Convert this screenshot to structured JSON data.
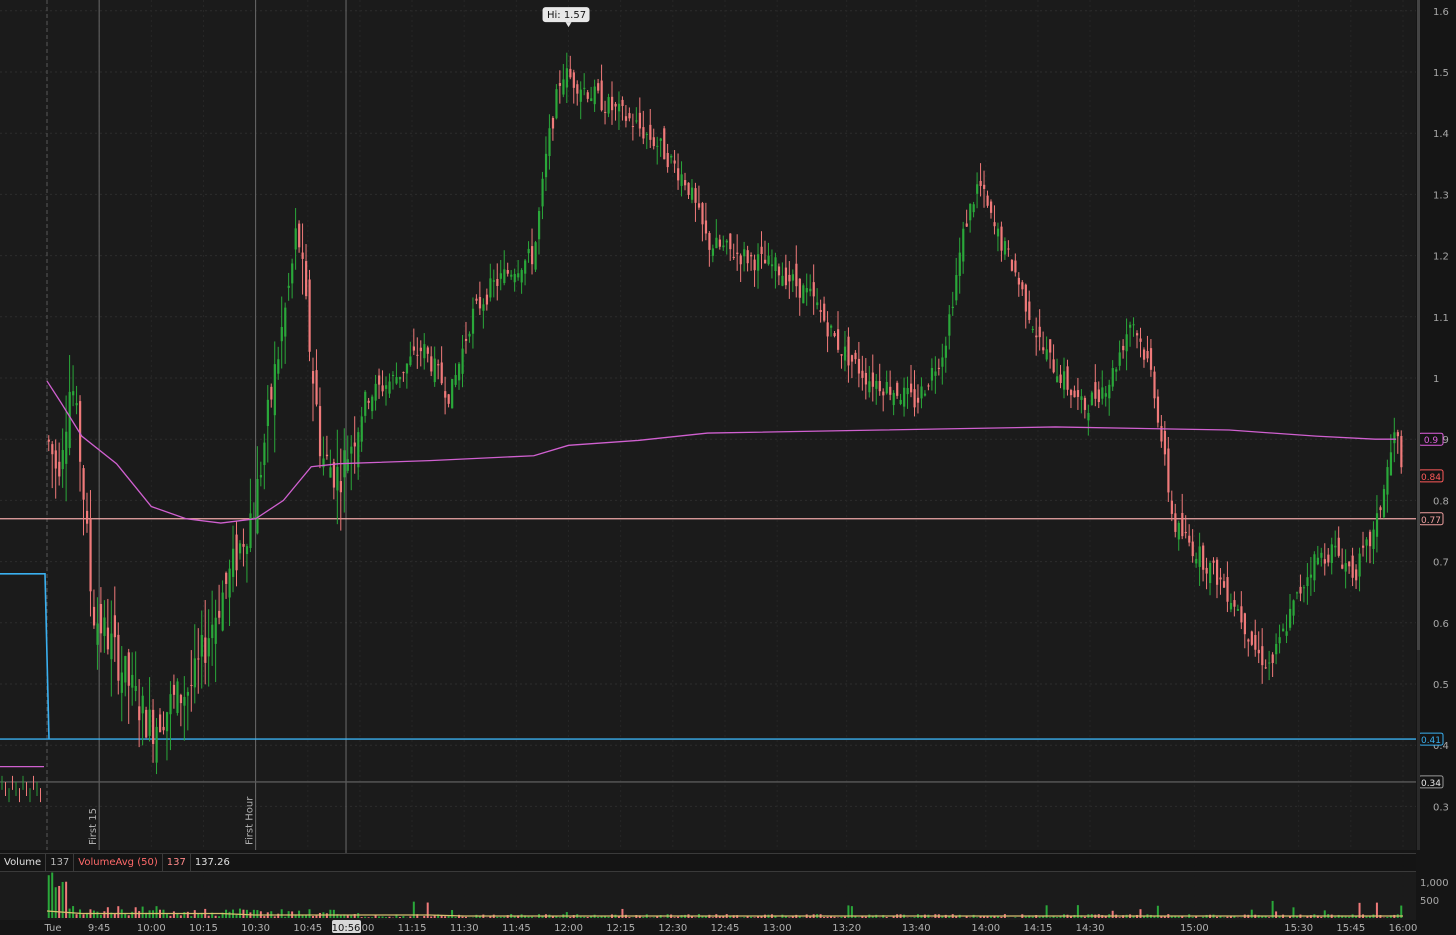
{
  "chart_data": {
    "type": "candlestick",
    "y_axis": {
      "range": [
        0.22,
        1.62
      ],
      "ticks": [
        "1.6",
        "1.5",
        "1.4",
        "1.3",
        "1.2",
        "1.1",
        "1",
        "0.9",
        "0.8",
        "0.7",
        "0.6",
        "0.5",
        "0.4",
        "0.3"
      ],
      "tick_values": [
        1.6,
        1.5,
        1.4,
        1.3,
        1.2,
        1.1,
        1.0,
        0.9,
        0.8,
        0.7,
        0.6,
        0.5,
        0.4,
        0.3
      ]
    },
    "time_axis": {
      "labels": [
        "Tue",
        "9:45",
        "10:00",
        "10:15",
        "10:30",
        "10:45",
        "11:00",
        "11:15",
        "11:30",
        "11:45",
        "12:00",
        "12:15",
        "12:30",
        "12:45",
        "13:00",
        "13:20",
        "13:40",
        "14:00",
        "14:15",
        "14:30",
        "15:00",
        "15:30",
        "15:45",
        "16:00"
      ],
      "minutes": [
        0,
        15,
        30,
        45,
        60,
        75,
        90,
        105,
        120,
        135,
        150,
        165,
        180,
        195,
        210,
        230,
        250,
        270,
        285,
        300,
        330,
        360,
        375,
        390
      ],
      "cursor_label": "10:56",
      "cursor_minute": 86
    },
    "annotations": {
      "high_label": "Hi: 1.57",
      "high_value": 1.57,
      "markers": [
        {
          "label": "First 15",
          "minute": 15
        },
        {
          "label": "First Hour",
          "minute": 60
        }
      ]
    },
    "price_tags": [
      {
        "label": "0.9",
        "value": 0.9,
        "color": "#e060e0"
      },
      {
        "label": "0.84",
        "value": 0.84,
        "color": "#ff5a5a"
      },
      {
        "label": "0.77",
        "value": 0.77,
        "color": "#f0a0a0"
      },
      {
        "label": "0.41",
        "value": 0.41,
        "color": "#3ab0f0"
      },
      {
        "label": "0.34",
        "value": 0.34,
        "color": "#9a9a9a"
      }
    ],
    "horizontal_lines": [
      {
        "value": 0.77,
        "color": "#f0a8a8"
      },
      {
        "value": 0.41,
        "color": "#3ab0f0"
      },
      {
        "value": 0.34,
        "color": "#5a5a5a"
      }
    ],
    "series_vwap": {
      "color": "#d060d0",
      "points": [
        [
          0,
          0.995
        ],
        [
          4,
          0.96
        ],
        [
          10,
          0.905
        ],
        [
          20,
          0.86
        ],
        [
          30,
          0.79
        ],
        [
          40,
          0.77
        ],
        [
          50,
          0.763
        ],
        [
          60,
          0.77
        ],
        [
          68,
          0.8
        ],
        [
          76,
          0.855
        ],
        [
          84,
          0.86
        ],
        [
          110,
          0.865
        ],
        [
          140,
          0.873
        ],
        [
          150,
          0.89
        ],
        [
          170,
          0.898
        ],
        [
          190,
          0.91
        ],
        [
          240,
          0.915
        ],
        [
          290,
          0.92
        ],
        [
          340,
          0.915
        ],
        [
          365,
          0.905
        ],
        [
          382,
          0.9
        ],
        [
          388,
          0.9
        ]
      ]
    },
    "premarket_levels": {
      "blue": {
        "value": 0.68,
        "color": "#3ab0f0"
      },
      "magenta": {
        "value": 0.365,
        "color": "#d060d0"
      }
    },
    "candles_seed": 7,
    "candle_path": [
      [
        0,
        0.9
      ],
      [
        3,
        0.85
      ],
      [
        7,
        1.0
      ],
      [
        10,
        0.85
      ],
      [
        13,
        0.62
      ],
      [
        18,
        0.57
      ],
      [
        22,
        0.52
      ],
      [
        26,
        0.47
      ],
      [
        30,
        0.43
      ],
      [
        36,
        0.47
      ],
      [
        42,
        0.5
      ],
      [
        48,
        0.61
      ],
      [
        54,
        0.7
      ],
      [
        60,
        0.8
      ],
      [
        65,
        0.99
      ],
      [
        70,
        1.16
      ],
      [
        72,
        1.25
      ],
      [
        75,
        1.08
      ],
      [
        79,
        0.87
      ],
      [
        84,
        0.84
      ],
      [
        92,
        0.97
      ],
      [
        100,
        1.0
      ],
      [
        108,
        1.05
      ],
      [
        116,
        0.97
      ],
      [
        122,
        1.1
      ],
      [
        128,
        1.15
      ],
      [
        134,
        1.18
      ],
      [
        140,
        1.2
      ],
      [
        144,
        1.38
      ],
      [
        148,
        1.5
      ],
      [
        153,
        1.48
      ],
      [
        160,
        1.45
      ],
      [
        168,
        1.42
      ],
      [
        176,
        1.38
      ],
      [
        184,
        1.32
      ],
      [
        190,
        1.22
      ],
      [
        200,
        1.2
      ],
      [
        210,
        1.18
      ],
      [
        220,
        1.13
      ],
      [
        228,
        1.05
      ],
      [
        236,
        1.0
      ],
      [
        244,
        0.98
      ],
      [
        250,
        0.96
      ],
      [
        258,
        1.05
      ],
      [
        264,
        1.25
      ],
      [
        268,
        1.32
      ],
      [
        272,
        1.25
      ],
      [
        278,
        1.18
      ],
      [
        286,
        1.05
      ],
      [
        292,
        1.0
      ],
      [
        298,
        0.95
      ],
      [
        306,
        1.0
      ],
      [
        312,
        1.1
      ],
      [
        318,
        1.0
      ],
      [
        324,
        0.76
      ],
      [
        330,
        0.72
      ],
      [
        336,
        0.68
      ],
      [
        342,
        0.63
      ],
      [
        348,
        0.55
      ],
      [
        352,
        0.53
      ],
      [
        358,
        0.62
      ],
      [
        364,
        0.7
      ],
      [
        370,
        0.72
      ],
      [
        376,
        0.68
      ],
      [
        382,
        0.75
      ],
      [
        388,
        0.92
      ],
      [
        390,
        0.82
      ]
    ],
    "volume_axis": {
      "ticks": [
        "1,000",
        "500"
      ],
      "tick_values": [
        1000,
        500
      ]
    },
    "volume_panel": {
      "name": "Volume",
      "value": "137",
      "avg_name": "VolumeAvg (50)",
      "avg_value": "137",
      "avg_value2": "137.26"
    }
  }
}
